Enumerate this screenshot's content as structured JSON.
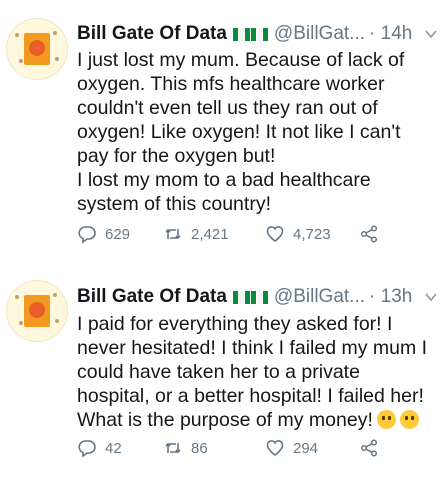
{
  "tweets": [
    {
      "author": "Bill Gate Of Data",
      "handle": "@BillGat...",
      "time": "· 14h",
      "text": "I just lost my mum. Because of lack of oxygen. This mfs healthcare worker couldn't even tell us they ran out of oxygen! Like oxygen! It not like I can't pay for the oxygen but!\nI lost my mom to a bad healthcare system of this country!",
      "replies": "629",
      "retweets": "2,421",
      "likes": "4,723"
    },
    {
      "author": "Bill Gate Of Data",
      "handle": "@BillGat...",
      "time": "· 13h",
      "text": "I paid for everything they asked for! I never hesitated! I think I failed my mum I could have taken her to a private hospital, or a better hospital! I failed her! What is the purpose of my money!",
      "replies": "42",
      "retweets": "86",
      "likes": "294"
    }
  ],
  "icons": {
    "reply": "reply-icon",
    "retweet": "retweet-icon",
    "like": "heart-icon",
    "share": "share-icon",
    "caret": "chevron-down-icon",
    "flag": "nigeria-flag-icon"
  }
}
